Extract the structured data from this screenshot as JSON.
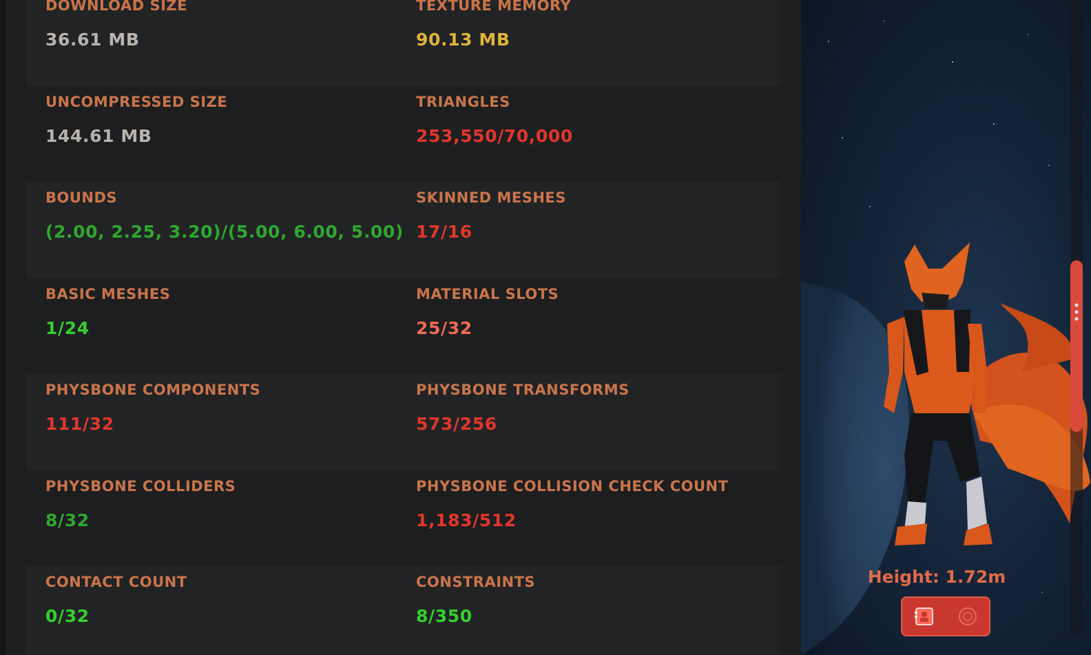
{
  "stats": {
    "rows": [
      [
        {
          "label": "DOWNLOAD SIZE",
          "value": "36.61 MB",
          "status": "neutral"
        },
        {
          "label": "TEXTURE MEMORY",
          "value": "90.13 MB",
          "status": "warning"
        }
      ],
      [
        {
          "label": "UNCOMPRESSED SIZE",
          "value": "144.61 MB",
          "status": "neutral"
        },
        {
          "label": "TRIANGLES",
          "value": "253,550/70,000",
          "status": "bad"
        }
      ],
      [
        {
          "label": "BOUNDS",
          "value": "(2.00, 2.25, 3.20)/(5.00, 6.00, 5.00)",
          "status": "good"
        },
        {
          "label": "SKINNED MESHES",
          "value": "17/16",
          "status": "bad"
        }
      ],
      [
        {
          "label": "BASIC MESHES",
          "value": "1/24",
          "status": "excellent"
        },
        {
          "label": "MATERIAL SLOTS",
          "value": "25/32",
          "status": "medium"
        }
      ],
      [
        {
          "label": "PHYSBONE COMPONENTS",
          "value": "111/32",
          "status": "bad"
        },
        {
          "label": "PHYSBONE TRANSFORMS",
          "value": "573/256",
          "status": "bad"
        }
      ],
      [
        {
          "label": "PHYSBONE COLLIDERS",
          "value": "8/32",
          "status": "good"
        },
        {
          "label": "PHYSBONE COLLISION CHECK COUNT",
          "value": "1,183/512",
          "status": "bad"
        }
      ],
      [
        {
          "label": "CONTACT COUNT",
          "value": "0/32",
          "status": "excellent"
        },
        {
          "label": "CONSTRAINTS",
          "value": "8/350",
          "status": "excellent"
        }
      ]
    ]
  },
  "preview": {
    "height_label": "Height: 1.72m",
    "action_icons": [
      "avatar-card-icon",
      "dropdown-circle-icon"
    ]
  },
  "colors": {
    "label": "#c9754a",
    "neutral": "#b9b3ae",
    "warning": "#e0b43a",
    "bad": "#e2362b",
    "medium": "#ef6b55",
    "good": "#2fa82f",
    "excellent": "#35cf2e",
    "accent": "#d94a3c",
    "height_label": "#e06a4a"
  },
  "scrollbar": {
    "position": 0.34,
    "visible_fraction": 0.27
  }
}
